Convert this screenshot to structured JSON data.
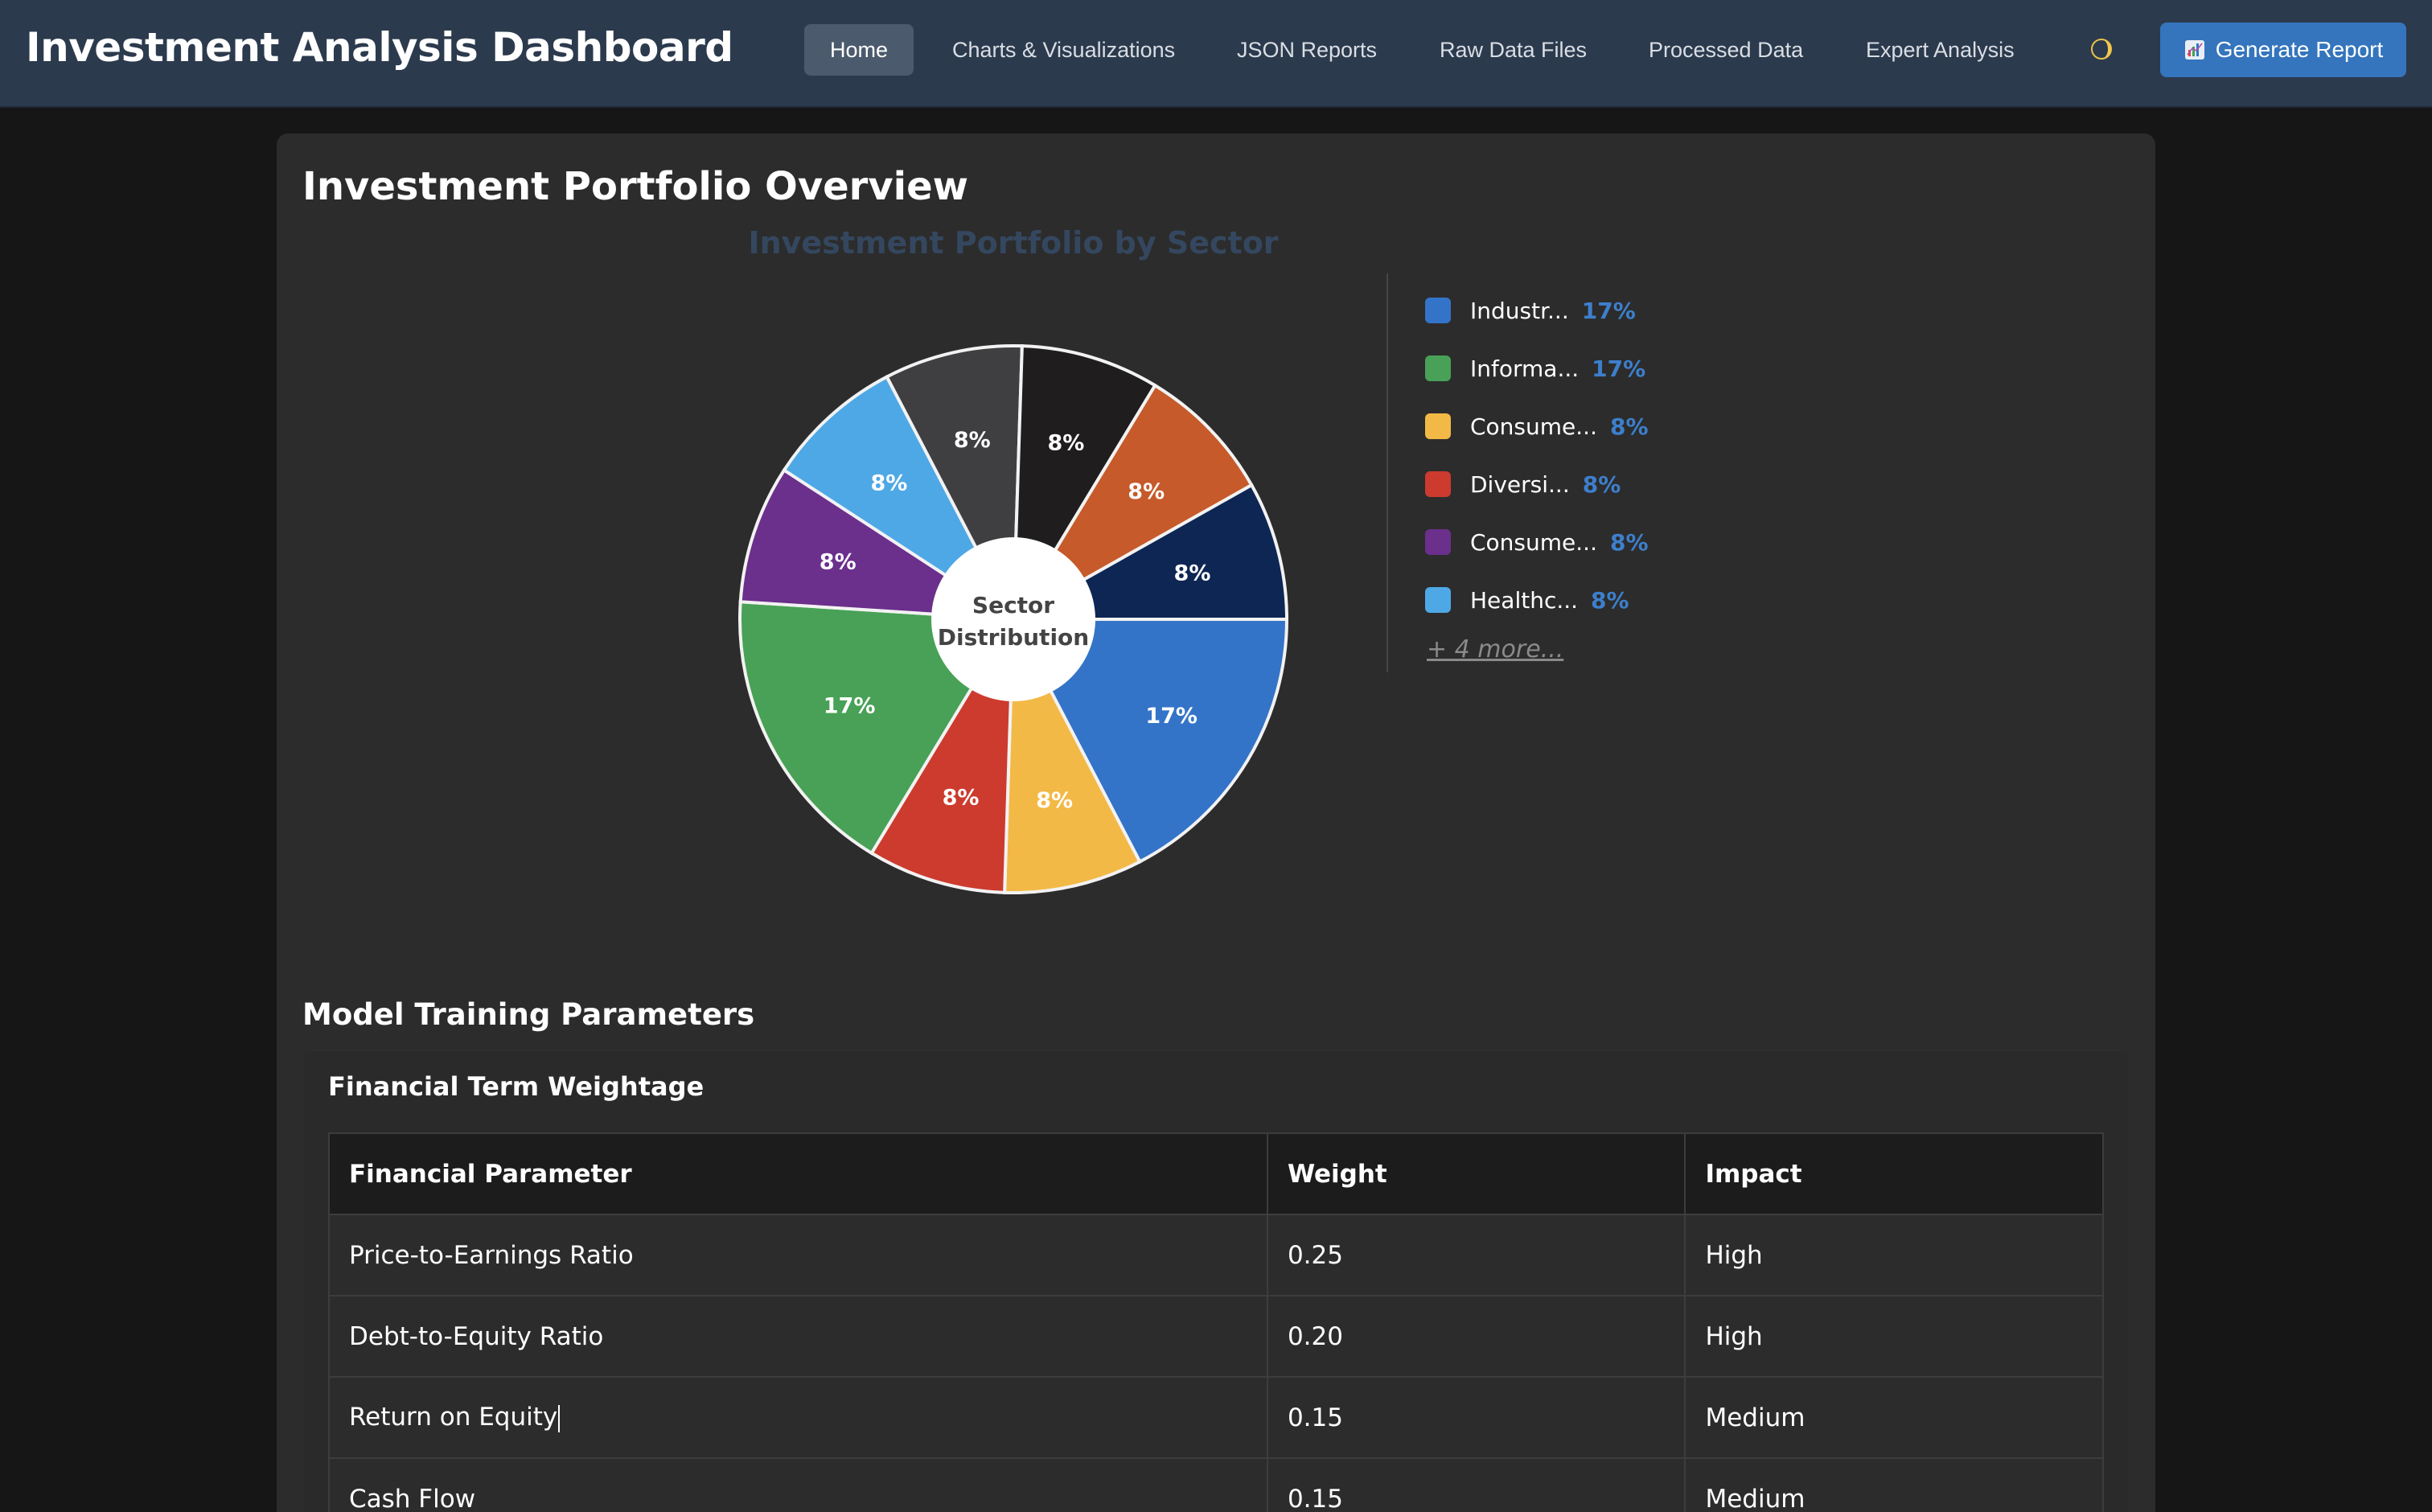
{
  "app": {
    "title": "Investment Analysis Dashboard"
  },
  "nav": {
    "items": [
      {
        "label": "Home",
        "active": true
      },
      {
        "label": "Charts & Visualizations",
        "active": false
      },
      {
        "label": "JSON Reports",
        "active": false
      },
      {
        "label": "Raw Data Files",
        "active": false
      },
      {
        "label": "Processed Data",
        "active": false
      },
      {
        "label": "Expert Analysis",
        "active": false
      }
    ],
    "theme_icon": "half-moon-icon",
    "generate_button": {
      "label": "Generate Report",
      "icon": "chart-icon"
    }
  },
  "overview": {
    "title": "Investment Portfolio Overview",
    "legend_more": "+ 4 more..."
  },
  "chart_data": {
    "type": "pie",
    "title": "Investment Portfolio by Sector",
    "center_label": [
      "Sector",
      "Distribution"
    ],
    "legend_placement": "right",
    "slices": [
      {
        "label": "Industr...",
        "percent": 17,
        "label_text": "17%",
        "color": "#3474c8"
      },
      {
        "label": "",
        "percent": 8,
        "label_text": "8%",
        "color": "#f3b946"
      },
      {
        "label": "",
        "percent": 8,
        "label_text": "8%",
        "color": "#cc3b2e"
      },
      {
        "label": "Informa...",
        "percent": 17,
        "label_text": "17%",
        "color": "#48a156"
      },
      {
        "label": "",
        "percent": 8,
        "label_text": "8%",
        "color": "#6b2f8c"
      },
      {
        "label": "",
        "percent": 8,
        "label_text": "8%",
        "color": "#4ea8e6"
      },
      {
        "label": "",
        "percent": 8,
        "label_text": "8%",
        "color": "#3f3f42"
      },
      {
        "label": "",
        "percent": 8,
        "label_text": "8%",
        "color": "#1f1d1e"
      },
      {
        "label": "",
        "percent": 8,
        "label_text": "8%",
        "color": "#c65a2a"
      },
      {
        "label": "",
        "percent": 8,
        "label_text": "8%",
        "color": "#0e2654"
      }
    ],
    "legend": [
      {
        "label": "Industr...",
        "percent": "17%",
        "color": "#3474c8"
      },
      {
        "label": "Informa...",
        "percent": "17%",
        "color": "#48a156"
      },
      {
        "label": "Consume...",
        "percent": "8%",
        "color": "#f3b946"
      },
      {
        "label": "Diversi...",
        "percent": "8%",
        "color": "#cc3b2e"
      },
      {
        "label": "Consume...",
        "percent": "8%",
        "color": "#6b2f8c"
      },
      {
        "label": "Healthc...",
        "percent": "8%",
        "color": "#4ea8e6"
      }
    ]
  },
  "model_params": {
    "title": "Model Training Parameters",
    "subtitle": "Financial Term Weightage",
    "columns": [
      "Financial Parameter",
      "Weight",
      "Impact"
    ],
    "rows": [
      [
        "Price-to-Earnings Ratio",
        "0.25",
        "High"
      ],
      [
        "Debt-to-Equity Ratio",
        "0.20",
        "High"
      ],
      [
        "Return on Equity",
        "0.15",
        "Medium"
      ],
      [
        "Cash Flow",
        "0.15",
        "Medium"
      ]
    ]
  }
}
